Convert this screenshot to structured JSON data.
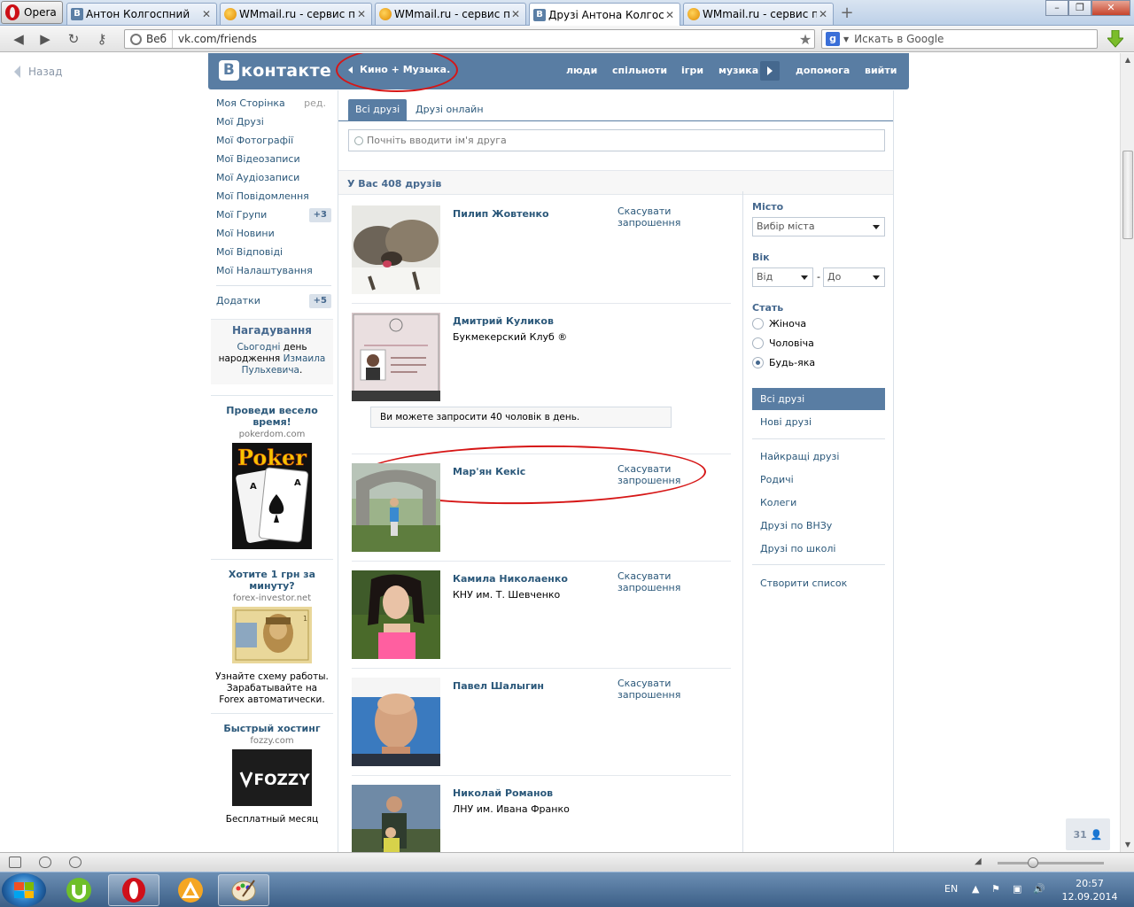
{
  "browser": {
    "menu_label": "Opera",
    "tabs": [
      {
        "title": "Антон Колгоспний",
        "favicon": "vk"
      },
      {
        "title": "WMmail.ru - сервис п...",
        "favicon": "wmmail"
      },
      {
        "title": "WMmail.ru - сервис п...",
        "favicon": "wmmail"
      },
      {
        "title": "Друзі Антона Колгосп...",
        "favicon": "vk",
        "active": true
      },
      {
        "title": "WMmail.ru - сервис п...",
        "favicon": "wmmail"
      }
    ],
    "address_badge": "Веб",
    "url": "vk.com/friends",
    "search_placeholder": "Искать в Google",
    "search_engine_icon": "g-icon"
  },
  "page": {
    "back_label": "Назад",
    "header": {
      "logo": "контакте",
      "logo_letter": "В",
      "player_track": "Кино + Музыка.",
      "nav": [
        "люди",
        "спільноти",
        "ігри",
        "музика",
        "допомога",
        "вийти"
      ]
    },
    "left_menu": {
      "items": [
        {
          "label": "Моя Сторінка",
          "extra": "ред."
        },
        {
          "label": "Мої Друзі"
        },
        {
          "label": "Мої Фотографії"
        },
        {
          "label": "Мої Відеозаписи"
        },
        {
          "label": "Мої Аудіозаписи"
        },
        {
          "label": "Мої Повідомлення"
        },
        {
          "label": "Мої Групи",
          "badge": "+3"
        },
        {
          "label": "Мої Новини"
        },
        {
          "label": "Мої Відповіді"
        },
        {
          "label": "Мої Налаштування"
        }
      ],
      "apps": {
        "label": "Додатки",
        "badge": "+5"
      }
    },
    "reminder": {
      "title": "Нагадування",
      "today": "Сьогодні",
      "text1": "день",
      "text2": "народження",
      "person": "Измаила Пульхевича",
      "dot": "."
    },
    "ads": [
      {
        "title": "Проведи весело время!",
        "domain": "pokerdom.com",
        "image_text": "Poker"
      },
      {
        "title": "Хотите 1 грн за минуту?",
        "domain": "forex-investor.net",
        "text": "Узнайте схему работы. Зарабатывайте на Forex автоматически."
      },
      {
        "title": "Быстрый хостинг",
        "domain": "fozzy.com",
        "image_text": "FOZZY",
        "text": "Бесплатный месяц"
      }
    ],
    "friends_tabs": [
      "Всі друзі",
      "Друзі онлайн"
    ],
    "friend_search_placeholder": "Почніть вводити ім'я друга",
    "friend_count_text": "У Вас 408 друзів",
    "friends": [
      {
        "name": "Пилип Жовтенко",
        "sub": "",
        "action": "Скасувати запрошення",
        "photo": "wolves"
      },
      {
        "name": "Дмитрий Куликов",
        "sub": "Букмекерский Клуб ®",
        "action": "",
        "photo": "passport"
      },
      {
        "name": "Мар'ян Кекіс",
        "sub": "",
        "action": "Скасувати запрошення",
        "photo": "park"
      },
      {
        "name": "Камила Николаенко",
        "sub": "КНУ им. Т. Шевченко",
        "action": "Скасувати запрошення",
        "photo": "girl"
      },
      {
        "name": "Павел Шалыгин",
        "sub": "",
        "action": "Скасувати запрошення",
        "photo": "bald-man"
      },
      {
        "name": "Николай Романов",
        "sub": "ЛНУ им. Ивана Франко",
        "action": "",
        "photo": "father-son"
      }
    ],
    "invite_notice": "Ви можете запросити 40 чоловік в день.",
    "filters": {
      "city_label": "Місто",
      "city_select": "Вибір міста",
      "age_label": "Вік",
      "age_from": "Від",
      "age_dash": "-",
      "age_to": "До",
      "gender_label": "Стать",
      "genders": [
        {
          "label": "Жіноча",
          "checked": false
        },
        {
          "label": "Чоловіча",
          "checked": false
        },
        {
          "label": "Будь-яка",
          "checked": true
        }
      ],
      "menu": [
        "Всі друзі",
        "Нові друзі",
        "Найкращі друзі",
        "Родичі",
        "Колеги",
        "Друзі по ВНЗу",
        "Друзі по школі",
        "Створити список"
      ]
    },
    "im_counter": "31"
  },
  "taskbar": {
    "lang": "EN",
    "time": "20:57",
    "date": "12.09.2014"
  },
  "colors": {
    "vk_blue": "#597da3",
    "vk_link": "#2b587a",
    "annotation_red": "#d61616"
  }
}
